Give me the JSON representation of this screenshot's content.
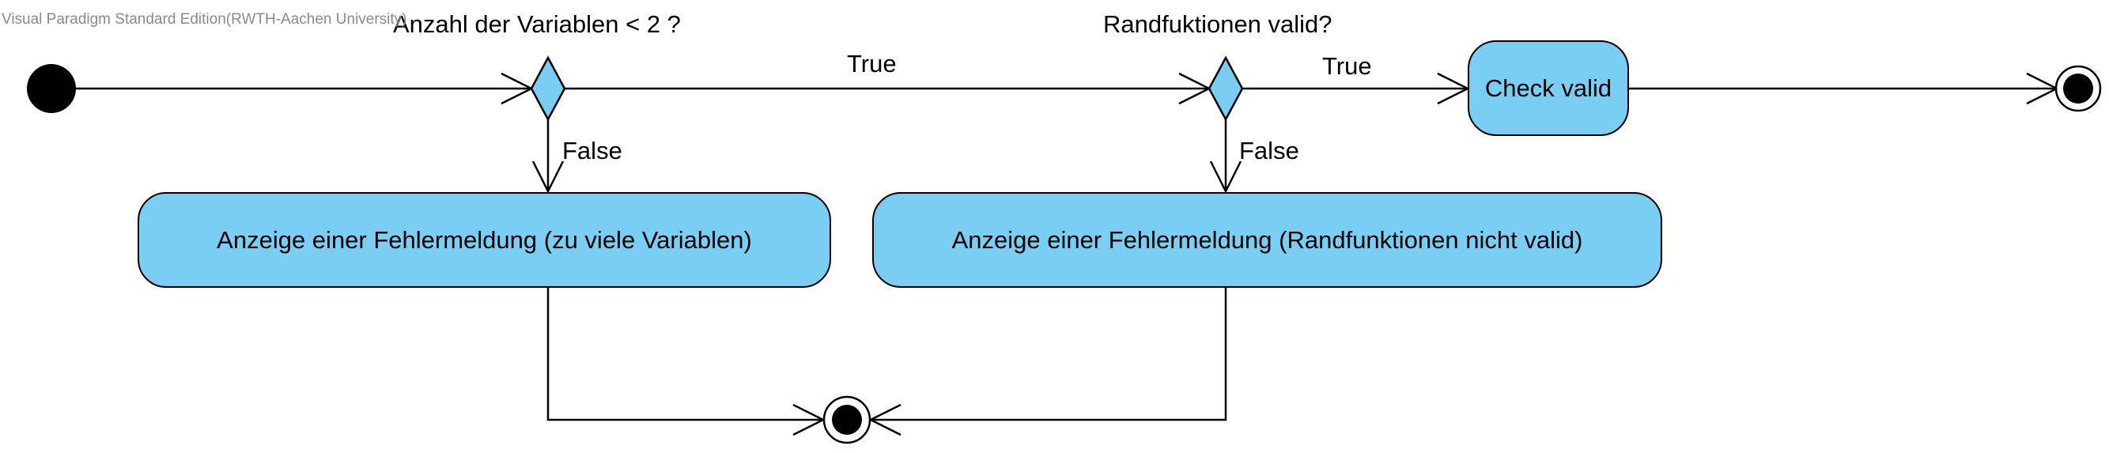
{
  "watermark": "Visual Paradigm Standard Edition(RWTH-Aachen University)",
  "decisions": {
    "first_guard_text": "Anzahl der Variablen < 2 ?",
    "second_guard_text": "Randfuktionen valid?"
  },
  "flows": {
    "true_label_1": "True",
    "true_label_2": "True",
    "false_label_1": "False",
    "false_label_2": "False"
  },
  "actions": {
    "check_valid": "Check valid",
    "error_too_many_variables": "Anzeige einer Fehlermeldung (zu viele Variablen)",
    "error_boundary_not_valid": "Anzeige einer Fehlermeldung (Randfunktionen nicht valid)"
  },
  "colors": {
    "action_fill": "#7acef4",
    "decision_fill": "#7acef4",
    "line": "#000000",
    "watermark": "#8a8a8a"
  }
}
